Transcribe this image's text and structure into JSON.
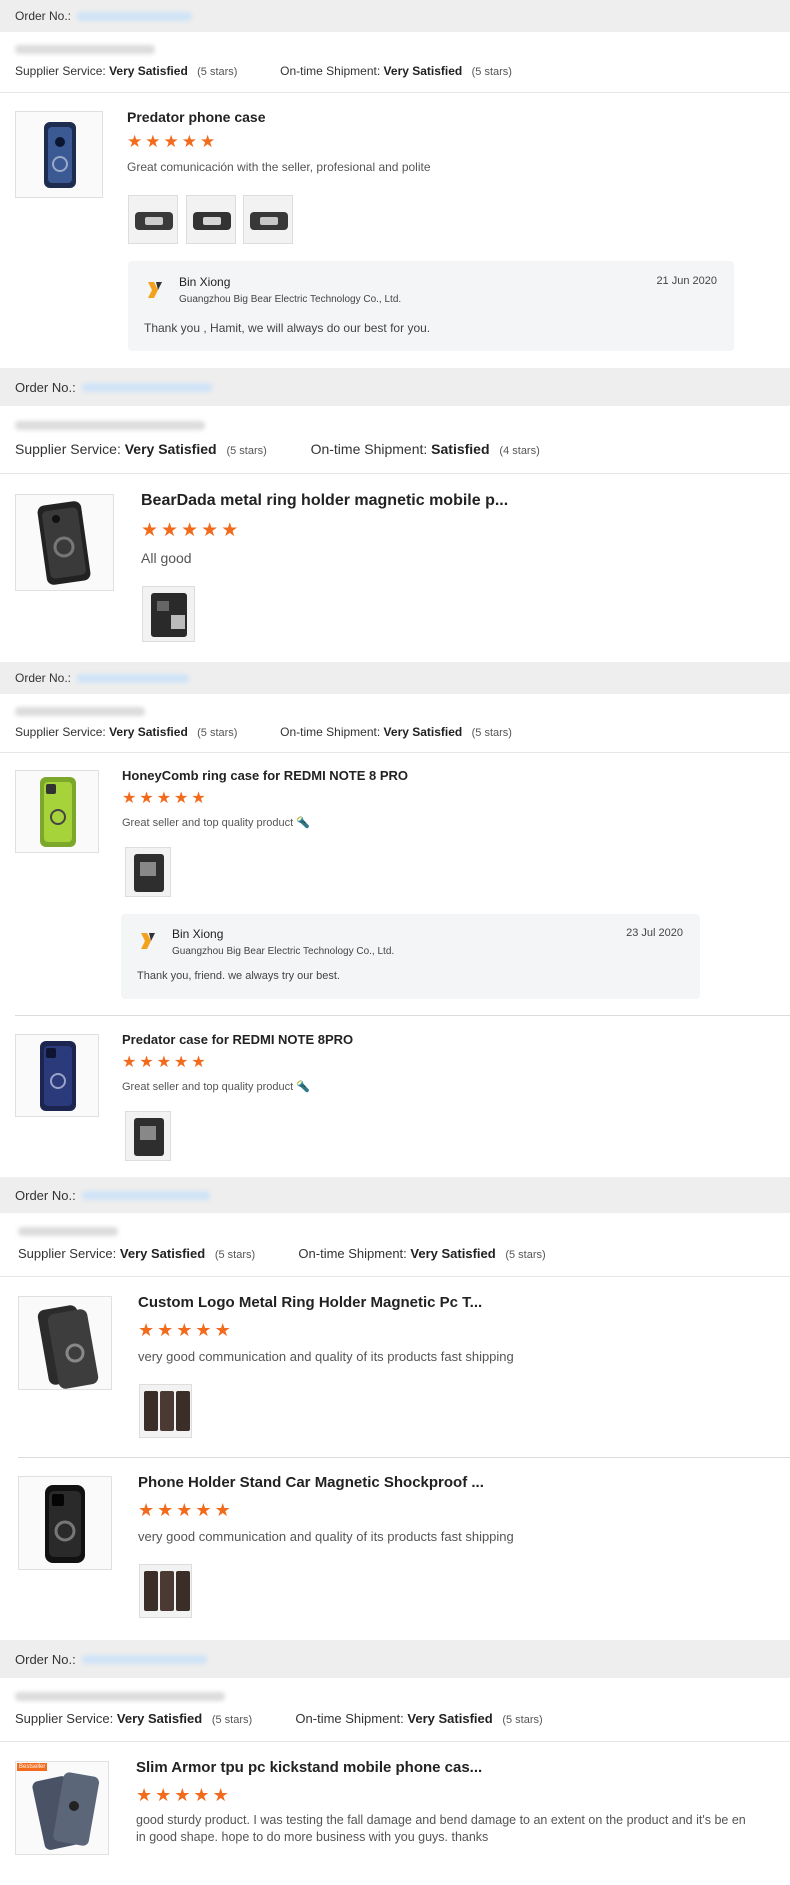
{
  "labels": {
    "order_no": "Order No.:",
    "supplier_service": "Supplier Service:",
    "ontime_shipment": "On-time Shipment:"
  },
  "colors": {
    "star": "#f26b1d",
    "order_bar": "#eeeeee",
    "reply_bg": "#f4f5f7"
  },
  "orders": [
    {
      "supplier_rating": "Very Satisfied",
      "supplier_stars": "(5 stars)",
      "shipment_rating": "Very Satisfied",
      "shipment_stars": "(5 stars)",
      "items": [
        {
          "title": "Predator phone case",
          "stars": 5,
          "review": "Great comunicación with the seller, profesional and polite",
          "reply": {
            "name": "Bin Xiong",
            "company": "Guangzhou Big Bear Electric Technology Co., Ltd.",
            "date": "21 Jun 2020",
            "message": "Thank you , Hamit, we will always do our best for you."
          }
        }
      ]
    },
    {
      "supplier_rating": "Very Satisfied",
      "supplier_stars": "(5 stars)",
      "shipment_rating": "Satisfied",
      "shipment_stars": "(4 stars)",
      "items": [
        {
          "title": "BearDada metal ring holder magnetic mobile p...",
          "stars": 5,
          "review": "All good"
        }
      ]
    },
    {
      "supplier_rating": "Very Satisfied",
      "supplier_stars": "(5 stars)",
      "shipment_rating": "Very Satisfied",
      "shipment_stars": "(5 stars)",
      "items": [
        {
          "title": "HoneyComb ring case for REDMI NOTE 8 PRO",
          "stars": 5,
          "review": "Great seller and top quality product 🔦",
          "reply": {
            "name": "Bin Xiong",
            "company": "Guangzhou Big Bear Electric Technology Co., Ltd.",
            "date": "23 Jul 2020",
            "message": "Thank you, friend. we always try our best."
          }
        },
        {
          "title": "Predator case for REDMI NOTE 8PRO",
          "stars": 5,
          "review": "Great seller and top quality product 🔦"
        }
      ]
    },
    {
      "supplier_rating": "Very Satisfied",
      "supplier_stars": "(5 stars)",
      "shipment_rating": "Very Satisfied",
      "shipment_stars": "(5 stars)",
      "items": [
        {
          "title": "Custom Logo Metal Ring Holder Magnetic Pc T...",
          "stars": 5,
          "review": "very good communication and quality of its products fast shipping"
        },
        {
          "title": "Phone Holder Stand Car Magnetic Shockproof ...",
          "stars": 5,
          "review": "very good communication and quality of its products fast shipping"
        }
      ]
    },
    {
      "supplier_rating": "Very Satisfied",
      "supplier_stars": "(5 stars)",
      "shipment_rating": "Very Satisfied",
      "shipment_stars": "(5 stars)",
      "items": [
        {
          "title": "Slim Armor tpu pc kickstand mobile phone cas...",
          "stars": 5,
          "review": "good sturdy product. I was testing the fall damage and bend damage to an extent on the product and it's be en in good shape. hope to do more business with you guys. thanks",
          "badge": "Bestseller"
        }
      ]
    }
  ]
}
